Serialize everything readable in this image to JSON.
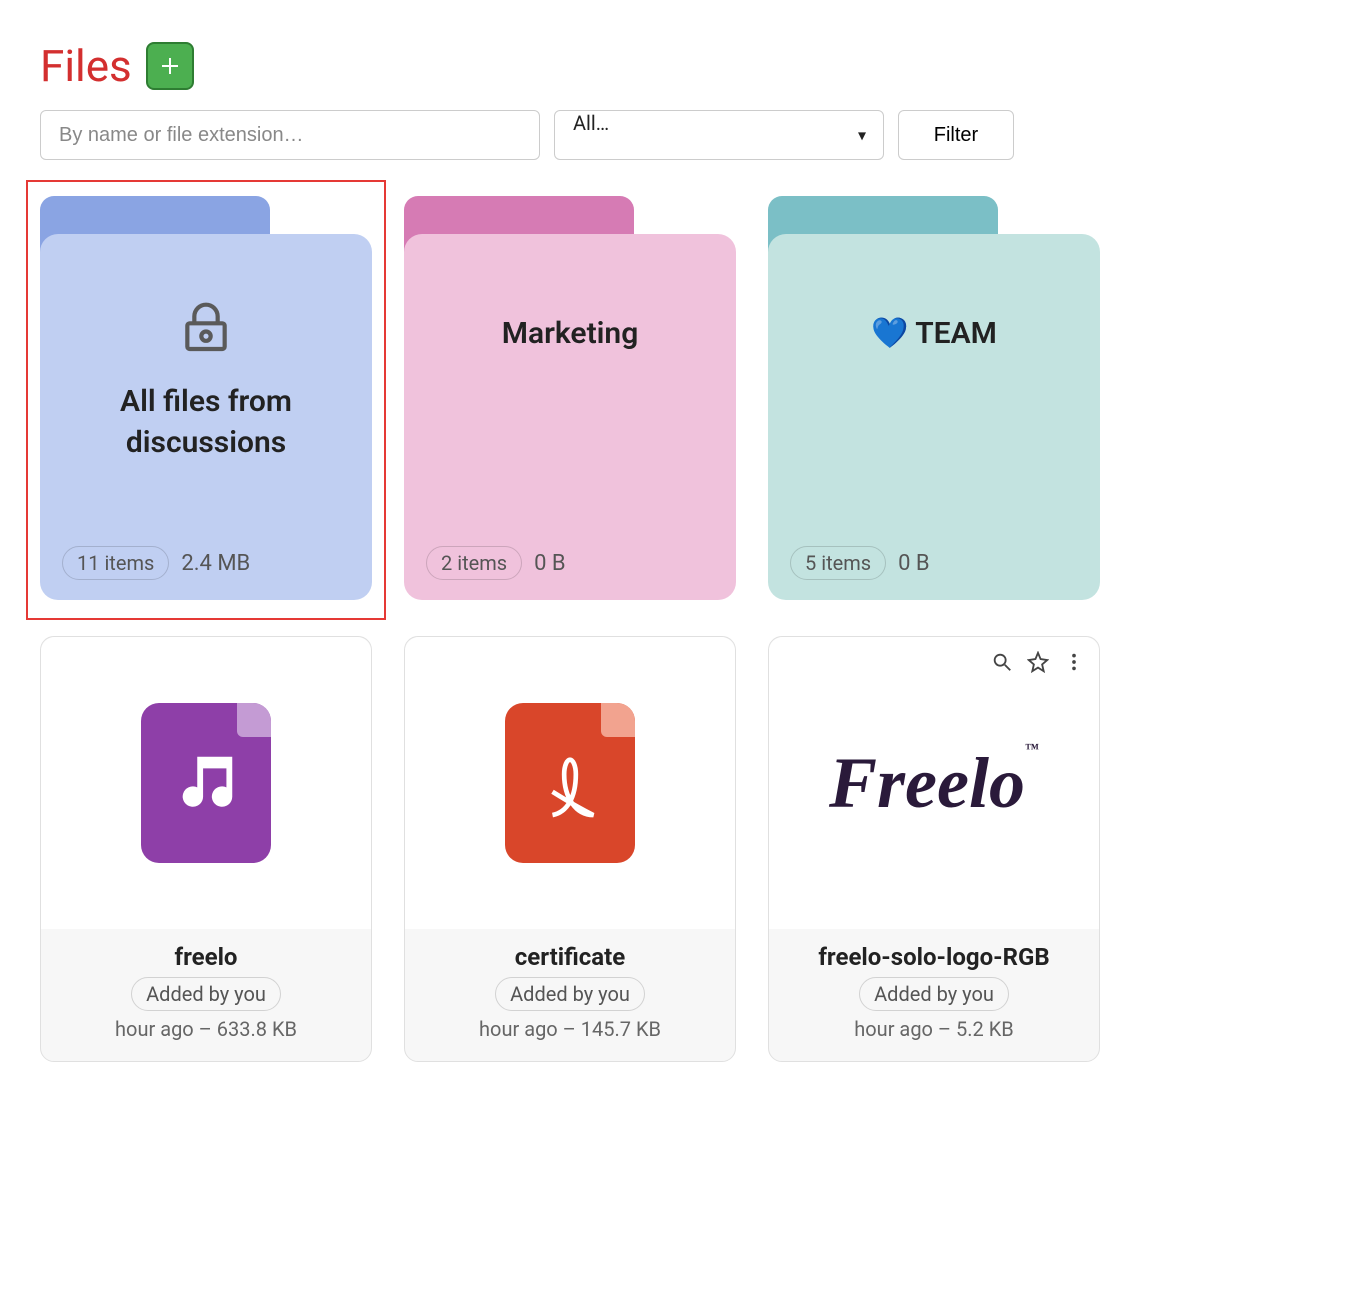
{
  "header": {
    "title": "Files"
  },
  "controls": {
    "search_placeholder": "By name or file extension…",
    "type_filter_selected": "All…",
    "filter_button": "Filter"
  },
  "folders": [
    {
      "name": "All files from discussions",
      "items_label": "11 items",
      "size": "2.4 MB",
      "locked": true,
      "highlighted": true,
      "colors": {
        "tab": "#8aa4e3",
        "body": "#c0cff2"
      }
    },
    {
      "name": "Marketing",
      "items_label": "2 items",
      "size": "0 B",
      "locked": false,
      "highlighted": false,
      "colors": {
        "tab": "#d67bb4",
        "body": "#f0c2dc"
      }
    },
    {
      "name": "💙 TEAM",
      "items_label": "5 items",
      "size": "0 B",
      "locked": false,
      "highlighted": false,
      "colors": {
        "tab": "#7bbfc6",
        "body": "#c3e3e0"
      }
    }
  ],
  "files": [
    {
      "name": "freelo",
      "added_by": "Added by you",
      "meta": "hour ago – 633.8 KB",
      "kind": "audio",
      "icon_color": "#8e3fa8",
      "corner_color": "#c49bd4"
    },
    {
      "name": "certificate",
      "added_by": "Added by you",
      "meta": "hour ago – 145.7 KB",
      "kind": "pdf",
      "icon_color": "#d9462a",
      "corner_color": "#f2a38f"
    },
    {
      "name": "freelo-solo-logo-RGB",
      "added_by": "Added by you",
      "meta": "hour ago – 5.2 KB",
      "kind": "image",
      "show_actions": true
    }
  ]
}
